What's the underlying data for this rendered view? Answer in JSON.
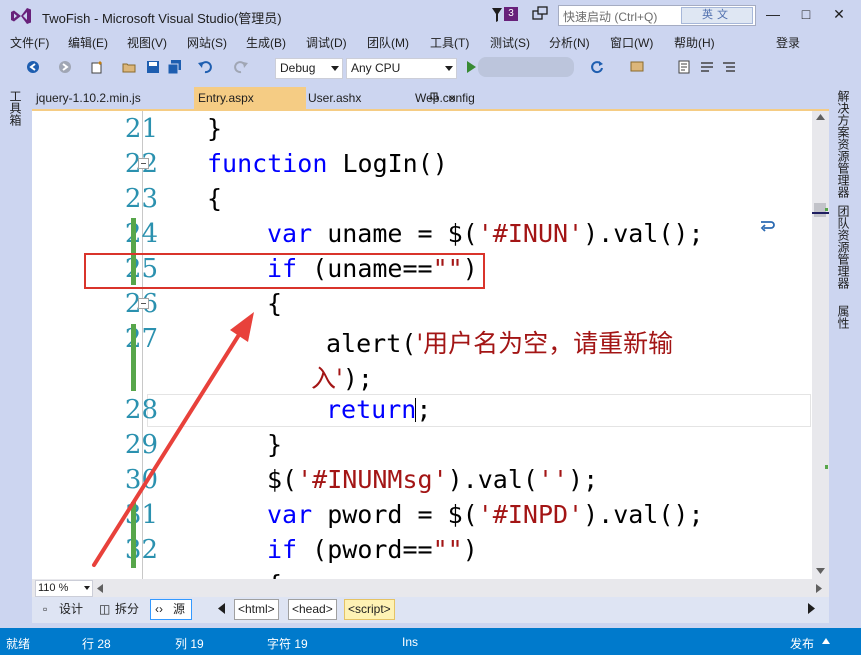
{
  "window": {
    "title": "TwoFish - Microsoft Visual Studio(管理员)",
    "notification_count": "3",
    "quick_launch_placeholder": "快速启动 (Ctrl+Q)",
    "ime_label": "英文",
    "sign_in": "登录"
  },
  "menu": [
    "文件(F)",
    "编辑(E)",
    "视图(V)",
    "网站(S)",
    "生成(B)",
    "调试(D)",
    "团队(M)",
    "工具(T)",
    "测试(S)",
    "分析(N)",
    "窗口(W)",
    "帮助(H)"
  ],
  "toolbar": {
    "configuration": "Debug",
    "platform": "Any CPU"
  },
  "side_panels": {
    "left": "工具箱",
    "right": [
      "解决方案资源管理器",
      "团队资源管理器",
      "属性"
    ]
  },
  "tabs": [
    {
      "label": "jquery-1.10.2.min.js",
      "active": false
    },
    {
      "label": "Entry.aspx",
      "active": true
    },
    {
      "label": "User.ashx",
      "active": false
    },
    {
      "label": "Web.config",
      "active": false
    }
  ],
  "editor": {
    "line_numbers": [
      "21",
      "22",
      "23",
      "24",
      "25",
      "26",
      "27",
      "28",
      "29",
      "30",
      "31",
      "32"
    ],
    "lines": {
      "l21": "}",
      "l22_kw": "function",
      "l22_rest": " LogIn()",
      "l23": "{",
      "l24_kw": "var",
      "l24_a": " uname = $(",
      "l24_str": "'#INUN'",
      "l24_b": ").val();",
      "l25_kw": "if",
      "l25_a": " (uname==",
      "l25_str": "\"\"",
      "l25_b": ")",
      "l26": "{",
      "l27_a": "alert(",
      "l27_str": "'用户名为空，请重新输",
      "l27_cont_str": "入'",
      "l27_cont_b": ");",
      "l28_kw": "return",
      "l28_b": ";",
      "l29": "}",
      "l30_a": "$(",
      "l30_str": "'#INUNMsg'",
      "l30_b": ").val(",
      "l30_str2": "''",
      "l30_c": ");",
      "l31_kw": "var",
      "l31_a": " pword = $(",
      "l31_str": "'#INPD'",
      "l31_b": ").val();",
      "l32_kw": "if",
      "l32_a": " (pword==",
      "l32_str": "\"\"",
      "l32_b": ")"
    },
    "zoom": "110 %"
  },
  "bottom": {
    "design": "设计",
    "split": "拆分",
    "source": "源",
    "crumbs": [
      "<html>",
      "<head>",
      "<script>"
    ]
  },
  "status": {
    "state": "就绪",
    "line": "行 28",
    "col": "列 19",
    "char": "字符 19",
    "mode": "Ins",
    "publish": "发布"
  },
  "colors": {
    "accent": "#007acc",
    "tab_active": "#f5cc84",
    "annotation": "#d9342b",
    "keyword": "#0000ff",
    "string": "#a31515",
    "line_number": "#2b91af"
  }
}
